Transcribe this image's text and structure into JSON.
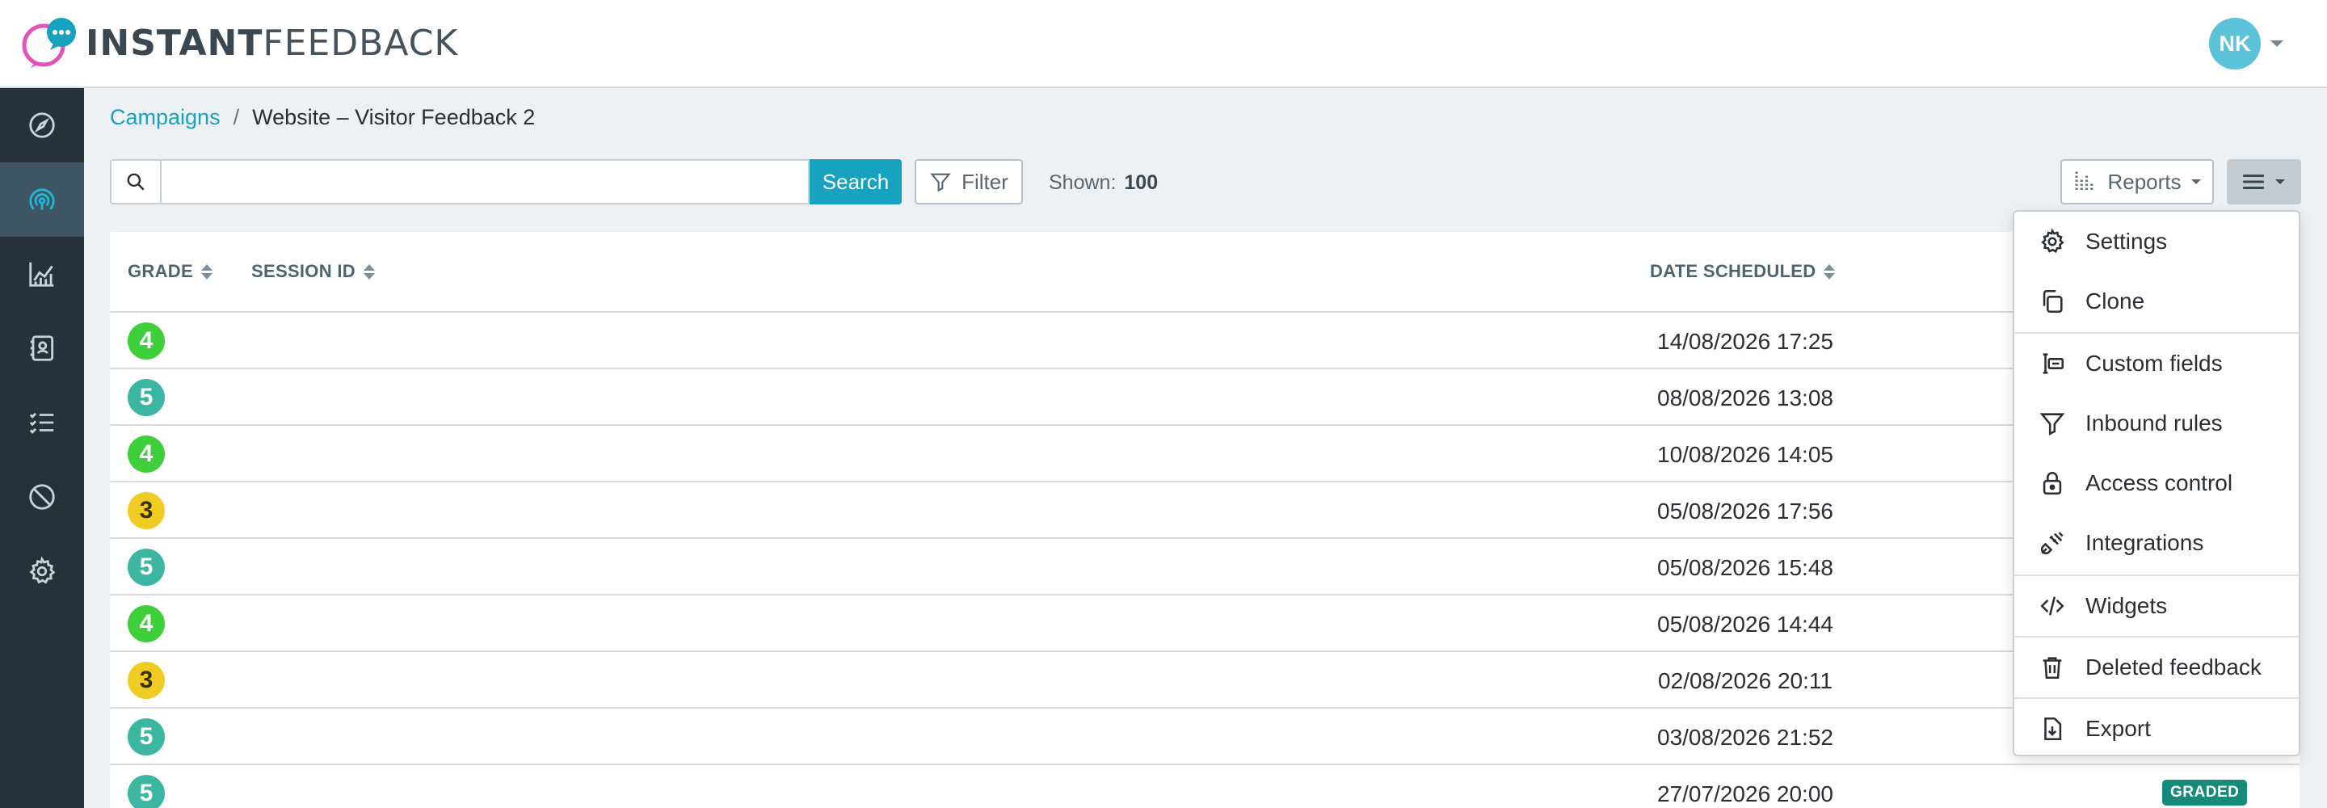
{
  "app": {
    "logo_bold": "INSTANT",
    "logo_thin": "FEEDBACK"
  },
  "user": {
    "initials": "NK"
  },
  "breadcrumb": {
    "parent": "Campaigns",
    "separator": "/",
    "current": "Website – Visitor Feedback 2"
  },
  "toolbar": {
    "search_value": "",
    "search_placeholder": "",
    "search_label": "Search",
    "filter_label": "Filter",
    "shown_label": "Shown:",
    "shown_count": "100",
    "reports_label": "Reports"
  },
  "table": {
    "headers": {
      "grade": "GRADE",
      "session_id": "SESSION ID",
      "date_scheduled": "DATE SCHEDULED"
    },
    "rows": [
      {
        "grade": "4",
        "date": "14/08/2026 17:25"
      },
      {
        "grade": "5",
        "date": "08/08/2026 13:08"
      },
      {
        "grade": "4",
        "date": "10/08/2026 14:05"
      },
      {
        "grade": "3",
        "date": "05/08/2026 17:56"
      },
      {
        "grade": "5",
        "date": "05/08/2026 15:48"
      },
      {
        "grade": "4",
        "date": "05/08/2026 14:44"
      },
      {
        "grade": "3",
        "date": "02/08/2026 20:11"
      },
      {
        "grade": "5",
        "date": "03/08/2026 21:52"
      },
      {
        "grade": "5",
        "date": "27/07/2026 20:00",
        "status": "GRADED"
      }
    ]
  },
  "menu": {
    "items": [
      {
        "label": "Settings",
        "icon": "gear-icon"
      },
      {
        "label": "Clone",
        "icon": "copy-icon"
      },
      {
        "label": "Custom fields",
        "icon": "custom-fields-icon"
      },
      {
        "label": "Inbound rules",
        "icon": "funnel-icon"
      },
      {
        "label": "Access control",
        "icon": "lock-icon"
      },
      {
        "label": "Integrations",
        "icon": "plug-icon"
      },
      {
        "label": "Widgets",
        "icon": "code-icon"
      },
      {
        "label": "Deleted feedback",
        "icon": "trash-icon"
      },
      {
        "label": "Export",
        "icon": "export-icon"
      }
    ]
  },
  "colors": {
    "accent": "#17a2c0",
    "sidebar": "#263238",
    "grade_4": "#3fcf3b",
    "grade_5": "#3bb6a0",
    "grade_3": "#f0cc22",
    "graded_badge": "#178a7a"
  }
}
